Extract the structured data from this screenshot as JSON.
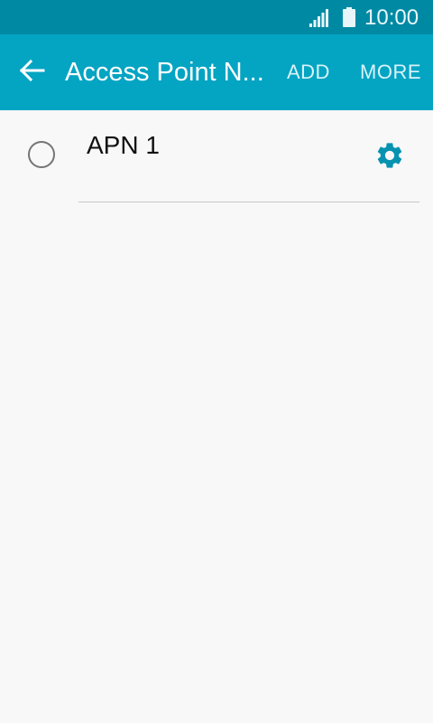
{
  "status_bar": {
    "time": "10:00",
    "signal_icon": "signal-icon",
    "battery_icon": "battery-icon"
  },
  "app_bar": {
    "back_icon": "arrow-left-icon",
    "title": "Access Point N...",
    "actions": {
      "add_label": "ADD",
      "more_label": "MORE"
    }
  },
  "apn_list": [
    {
      "name": "APN 1",
      "selected": false,
      "settings_icon": "gear-icon"
    }
  ],
  "colors": {
    "status_bar": "#0089a3",
    "app_bar": "#04a4c3",
    "accent": "#0793b0",
    "background": "#f8f8f8"
  }
}
